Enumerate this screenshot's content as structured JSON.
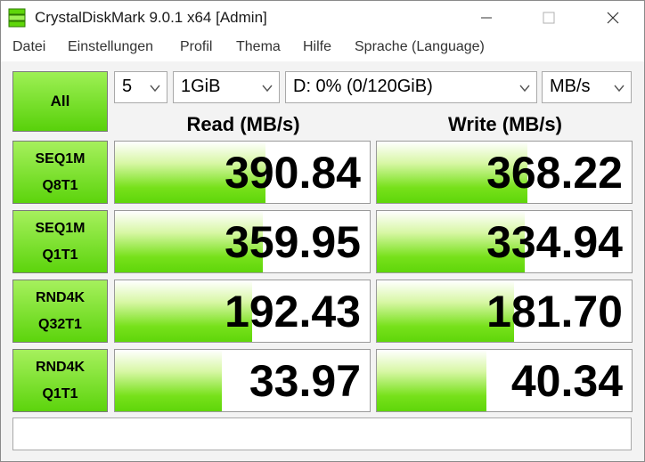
{
  "window": {
    "title": "CrystalDiskMark 9.0.1 x64 [Admin]",
    "icon": "crystaldiskmark-icon",
    "controls": [
      "minimize-icon",
      "maximize-icon",
      "close-icon"
    ]
  },
  "menu": {
    "items": [
      "Datei",
      "Einstellungen",
      "Profil",
      "Thema",
      "Hilfe",
      "Sprache (Language)"
    ]
  },
  "toolbar": {
    "all_label": "All",
    "count": "5",
    "size": "1GiB",
    "drive": "D: 0% (0/120GiB)",
    "unit": "MB/s"
  },
  "headers": {
    "read": "Read (MB/s)",
    "write": "Write (MB/s)"
  },
  "tests": [
    {
      "line1": "SEQ1M",
      "line2": "Q8T1",
      "read": "390.84",
      "write": "368.22",
      "read_fill": 0.59,
      "write_fill": 0.59
    },
    {
      "line1": "SEQ1M",
      "line2": "Q1T1",
      "read": "359.95",
      "write": "334.94",
      "read_fill": 0.58,
      "write_fill": 0.58
    },
    {
      "line1": "RND4K",
      "line2": "Q32T1",
      "read": "192.43",
      "write": "181.70",
      "read_fill": 0.54,
      "write_fill": 0.54
    },
    {
      "line1": "RND4K",
      "line2": "Q1T1",
      "read": "33.97",
      "write": "40.34",
      "read_fill": 0.42,
      "write_fill": 0.43
    }
  ],
  "comment": "",
  "colors": {
    "accent_green": "#5fd60a",
    "button_green_top": "#a6f05d"
  }
}
